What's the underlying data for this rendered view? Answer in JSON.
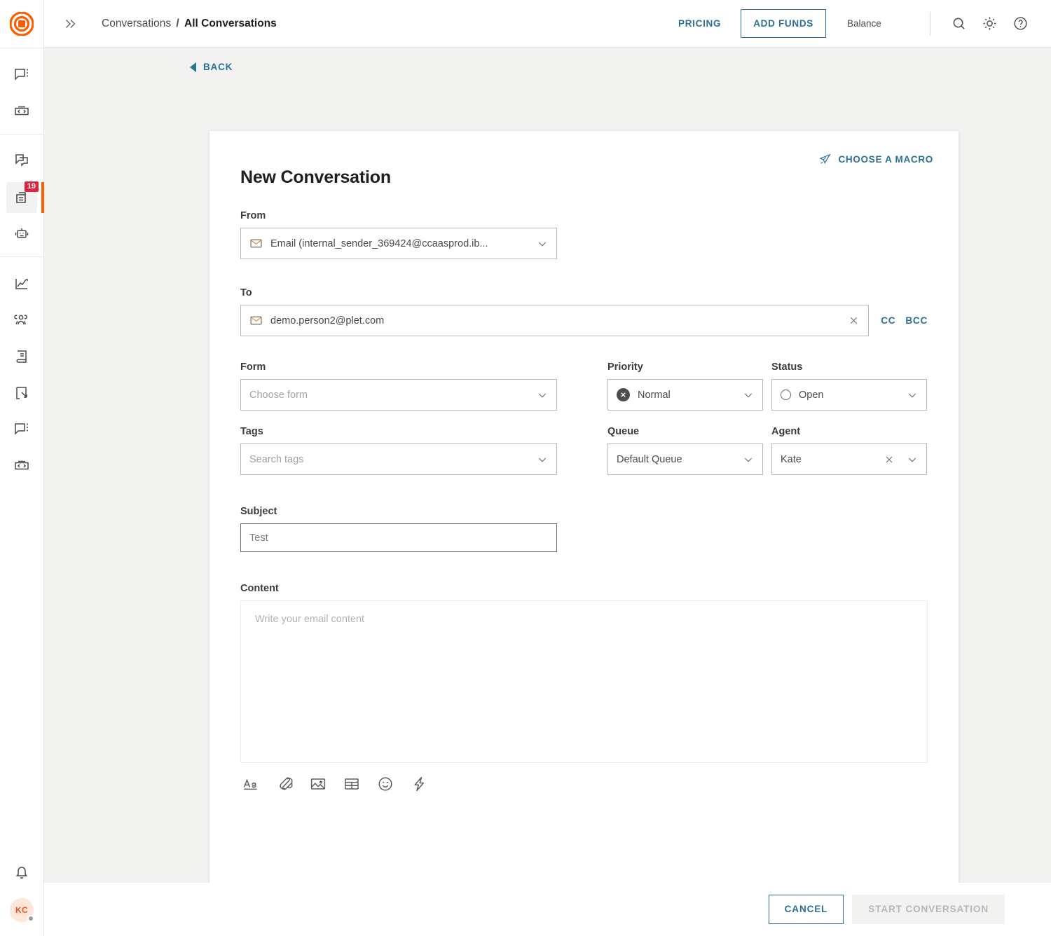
{
  "brand": {
    "logo_color": "#ff5c00",
    "accent_link": "#2b7096",
    "badge_color": "#e0223c"
  },
  "sidebar": {
    "logo_name": "app-logo",
    "groups": [
      {
        "items": [
          {
            "name": "chat-more-icon",
            "badge": null,
            "active": false
          },
          {
            "name": "code-box-icon",
            "badge": null,
            "active": false
          }
        ]
      },
      {
        "items": [
          {
            "name": "conversations-stack-icon",
            "badge": null,
            "active": false
          },
          {
            "name": "inbox-archive-icon",
            "badge": "19",
            "active": true
          },
          {
            "name": "bot-icon",
            "badge": null,
            "active": false
          }
        ]
      },
      {
        "items": [
          {
            "name": "analytics-icon",
            "badge": null,
            "active": false
          },
          {
            "name": "contacts-icon",
            "badge": null,
            "active": false
          },
          {
            "name": "knowledge-book-icon",
            "badge": null,
            "active": false
          },
          {
            "name": "flow-builder-icon",
            "badge": null,
            "active": false
          },
          {
            "name": "chat-more-icon-2",
            "badge": null,
            "active": false
          },
          {
            "name": "code-box-icon-2",
            "badge": null,
            "active": false
          }
        ]
      }
    ],
    "notifications_icon": "bell-icon",
    "avatar_initials": "KC",
    "avatar_status": "offline"
  },
  "header": {
    "collapse_icon": "chevron-double-right-icon",
    "breadcrumb": {
      "parent": "Conversations",
      "separator": "/",
      "current": "All Conversations"
    },
    "pricing_label": "PRICING",
    "add_funds_label": "ADD FUNDS",
    "balance_label": "Balance",
    "search_icon": "search-icon",
    "theme_icon": "sun-icon",
    "help_icon": "help-circle-icon"
  },
  "back": {
    "label": "BACK",
    "icon": "triangle-left-icon"
  },
  "card": {
    "macro": {
      "label": "CHOOSE A MACRO",
      "icon": "paper-plane-icon"
    },
    "title": "New Conversation",
    "from": {
      "label": "From",
      "value": "Email (internal_sender_369424@ccaasprod.ib...",
      "icon": "envelope-icon",
      "caret": "chevron-down-icon"
    },
    "to": {
      "label": "To",
      "value": "demo.person2@plet.com",
      "icon": "envelope-icon",
      "clear_icon": "close-icon",
      "cc_label": "CC",
      "bcc_label": "BCC"
    },
    "form": {
      "label": "Form",
      "placeholder": "Choose form",
      "value": ""
    },
    "priority": {
      "label": "Priority",
      "value": "Normal",
      "icon": "priority-normal-icon"
    },
    "status": {
      "label": "Status",
      "value": "Open",
      "icon": "status-open-icon"
    },
    "tags": {
      "label": "Tags",
      "placeholder": "Search tags",
      "value": ""
    },
    "queue": {
      "label": "Queue",
      "value": "Default Queue"
    },
    "agent": {
      "label": "Agent",
      "value": "Kate",
      "clear_icon": "close-icon"
    },
    "subject": {
      "label": "Subject",
      "value": "Test"
    },
    "content": {
      "label": "Content",
      "placeholder": "Write your email content"
    },
    "editor_tools": [
      {
        "name": "text-format-icon",
        "label": "Aa"
      },
      {
        "name": "attachment-icon",
        "label": ""
      },
      {
        "name": "image-icon",
        "label": ""
      },
      {
        "name": "table-icon",
        "label": ""
      },
      {
        "name": "emoji-icon",
        "label": ""
      },
      {
        "name": "quick-reply-lightning-icon",
        "label": ""
      }
    ]
  },
  "footer": {
    "cancel_label": "CANCEL",
    "start_label": "START CONVERSATION",
    "start_disabled": true
  }
}
